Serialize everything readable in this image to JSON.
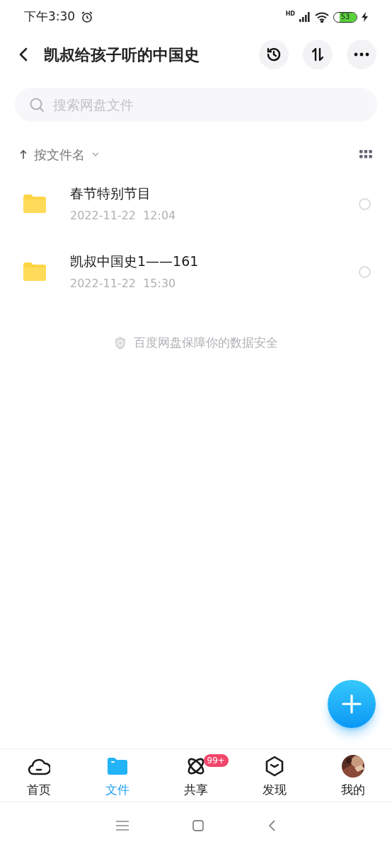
{
  "status_bar": {
    "time": "下午3:30",
    "network": "HD",
    "battery": "53"
  },
  "header": {
    "title": "凯叔给孩子听的中国史"
  },
  "search": {
    "placeholder": "搜索网盘文件"
  },
  "sort": {
    "label": "按文件名"
  },
  "files": [
    {
      "name": "春节特别节目",
      "date": "2022-11-22  12:04",
      "selected": false
    },
    {
      "name": "凯叔中国史1——161",
      "date": "2022-11-22  15:30",
      "selected": false
    }
  ],
  "footer_note": "百度网盘保障你的数据安全",
  "tabs": [
    {
      "kind": "home",
      "label": "首页",
      "selected": false
    },
    {
      "kind": "files",
      "label": "文件",
      "selected": true
    },
    {
      "kind": "share",
      "label": "共享",
      "selected": false,
      "badge": "99+"
    },
    {
      "kind": "discover",
      "label": "发现",
      "selected": false
    },
    {
      "kind": "me",
      "label": "我的",
      "selected": false
    }
  ]
}
